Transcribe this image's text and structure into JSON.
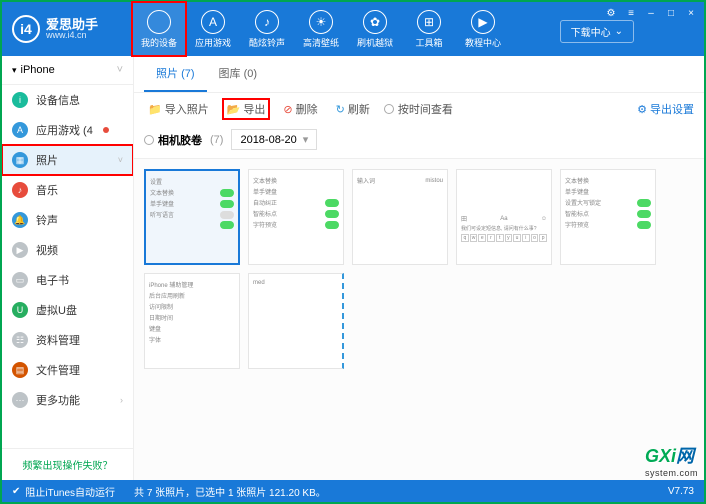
{
  "header": {
    "logo_text": "爱思助手",
    "logo_url": "www.i4.cn",
    "nav": [
      {
        "label": "我的设备",
        "glyph": ""
      },
      {
        "label": "应用游戏",
        "glyph": "A"
      },
      {
        "label": "酷炫铃声",
        "glyph": "♪"
      },
      {
        "label": "高清壁纸",
        "glyph": "☀"
      },
      {
        "label": "刷机越狱",
        "glyph": "✿"
      },
      {
        "label": "工具箱",
        "glyph": "⊞"
      },
      {
        "label": "教程中心",
        "glyph": "▶"
      }
    ],
    "download_center": "下载中心",
    "win": {
      "settings": "⚙",
      "menu": "≡",
      "min": "–",
      "max": "□",
      "close": "×"
    }
  },
  "sidebar": {
    "device": "iPhone",
    "items": [
      {
        "label": "设备信息",
        "color": "#1abc9c",
        "glyph": "i"
      },
      {
        "label": "应用游戏",
        "color": "#3498db",
        "glyph": "A",
        "badge": true,
        "count": "4"
      },
      {
        "label": "照片",
        "color": "#3498db",
        "glyph": "▦",
        "selected": true,
        "chev": "˅"
      },
      {
        "label": "音乐",
        "color": "#e74c3c",
        "glyph": "♪"
      },
      {
        "label": "铃声",
        "color": "#3498db",
        "glyph": "🔔"
      },
      {
        "label": "视频",
        "color": "#bdc3c7",
        "glyph": "▶"
      },
      {
        "label": "电子书",
        "color": "#bdc3c7",
        "glyph": "▭"
      },
      {
        "label": "虚拟U盘",
        "color": "#27ae60",
        "glyph": "U"
      },
      {
        "label": "资料管理",
        "color": "#bdc3c7",
        "glyph": "☷"
      },
      {
        "label": "文件管理",
        "color": "#d35400",
        "glyph": "▤"
      },
      {
        "label": "更多功能",
        "color": "#bdc3c7",
        "glyph": "⋯",
        "chev": "›"
      }
    ],
    "footer": "频繁出现操作失败？"
  },
  "main": {
    "tabs": [
      {
        "label": "照片",
        "count": "(7)",
        "active": true
      },
      {
        "label": "图库",
        "count": "(0)"
      }
    ],
    "toolbar": {
      "import": "导入照片",
      "export": "导出",
      "delete": "删除",
      "refresh": "刷新",
      "timesearch": "按时间查看",
      "export_settings": "导出设置"
    },
    "filter": {
      "album": "相机胶卷",
      "count": "(7)",
      "date": "2018-08-20"
    },
    "thumbs": {
      "t1_lines": [
        "设置",
        "文本替换",
        "单手键盘",
        "听写语言"
      ],
      "t2_lines": [
        "文本替换",
        "单手键盘",
        "自动纠正",
        "智能标点",
        "字符预览"
      ],
      "t3_title": "输入词",
      "t3_sub": "mistou",
      "t4_text": "我们可设定短信息, 请问有什么事?",
      "t4_mode": [
        "田",
        "Aa",
        "☺"
      ],
      "t4_keys": [
        "q",
        "w",
        "e",
        "r",
        "t",
        "y",
        "u",
        "i",
        "o",
        "p"
      ],
      "t5_lines": [
        "文本替换",
        "单手键盘",
        "设置大写锁定",
        "智能标点",
        "字符预览"
      ],
      "t6_lines": [
        "iPhone 辅助管理",
        "后台应用刷新",
        "访问限制",
        "日期时间",
        "键盘",
        "字体"
      ],
      "t7_label": "med"
    }
  },
  "status": {
    "itunes": "阻止iTunes自动运行",
    "info": "共 7 张照片，已选中 1 张照片 121.20 KB。",
    "version": "V7.73"
  },
  "watermark": {
    "main": "GXi",
    "suffix": "网",
    "sub": "system.com"
  }
}
